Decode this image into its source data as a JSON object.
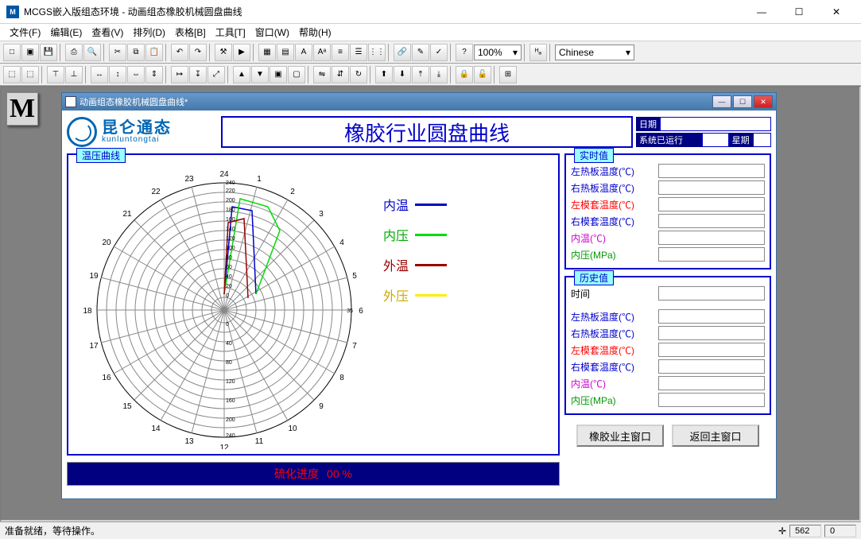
{
  "app": {
    "title": "MCGS嵌入版组态环境 - 动画组态橡胶机械圆盘曲线"
  },
  "menu": {
    "file": "文件(F)",
    "edit": "编辑(E)",
    "view": "查看(V)",
    "arrange": "排列(D)",
    "table": "表格[B]",
    "tool": "工具[T]",
    "window": "窗口(W)",
    "help": "帮助(H)"
  },
  "toolbar": {
    "zoom": "100%",
    "lang": "Chinese"
  },
  "child": {
    "title": "动画组态橡胶机械圆盘曲线*"
  },
  "header": {
    "bigtitle": "橡胶行业圆盘曲线",
    "logo_cn": "昆仑通态",
    "logo_en": "kunluntongtai",
    "date_label": "日期",
    "runtime_label": "系统已运行",
    "week_label": "星期"
  },
  "groups": {
    "polar": "温压曲线",
    "realtime": "实时值",
    "history": "历史值"
  },
  "legend": {
    "inner_temp": {
      "label": "内温",
      "color": "#0000cc"
    },
    "inner_press": {
      "label": "内压",
      "color": "#00dd00"
    },
    "outer_temp": {
      "label": "外温",
      "color": "#990000"
    },
    "outer_press": {
      "label": "外压",
      "color": "#ffee00"
    }
  },
  "realtime": {
    "r0": {
      "label": "左热板温度(℃)",
      "color": "#0000cc"
    },
    "r1": {
      "label": "右热板温度(℃)",
      "color": "#0000cc"
    },
    "r2": {
      "label": "左模套温度(℃)",
      "color": "#ff0000"
    },
    "r3": {
      "label": "右模套温度(℃)",
      "color": "#0000cc"
    },
    "r4": {
      "label": "内温(℃)",
      "color": "#cc00cc"
    },
    "r5": {
      "label": "内压(MPa)",
      "color": "#009900"
    }
  },
  "history": {
    "time_label": "时间",
    "h0": {
      "label": "左热板温度(℃)",
      "color": "#0000cc"
    },
    "h1": {
      "label": "右热板温度(℃)",
      "color": "#0000cc"
    },
    "h2": {
      "label": "左模套温度(℃)",
      "color": "#ff0000"
    },
    "h3": {
      "label": "右模套温度(℃)",
      "color": "#0000cc"
    },
    "h4": {
      "label": "内温(℃)",
      "color": "#cc00cc"
    },
    "h5": {
      "label": "内压(MPa)",
      "color": "#009900"
    }
  },
  "progress": {
    "label": "硫化进度",
    "value": "00 %"
  },
  "buttons": {
    "rubber": "橡胶业主窗口",
    "main": "返回主窗口"
  },
  "status": {
    "text": "准备就绪，等待操作。",
    "x": "562",
    "y": "0"
  },
  "chart_data": {
    "type": "polar",
    "hours": [
      1,
      2,
      3,
      4,
      5,
      6,
      7,
      8,
      9,
      10,
      11,
      12,
      13,
      14,
      15,
      16,
      17,
      18,
      19,
      20,
      21,
      22,
      23,
      24
    ],
    "radial_ticks": [
      0,
      20,
      40,
      60,
      80,
      100,
      120,
      140,
      160,
      180,
      200,
      220,
      240
    ],
    "radial_ticks_south": [
      0,
      40,
      80,
      120,
      160,
      200,
      240
    ],
    "series": [
      {
        "name": "内温",
        "color": "#0000cc"
      },
      {
        "name": "内压",
        "color": "#00dd00"
      },
      {
        "name": "外温",
        "color": "#990000"
      },
      {
        "name": "外压",
        "color": "#ffee00"
      }
    ],
    "note": "Sample traces visible between hours 23–3 near radius 180–220; exact data points not labeled."
  }
}
